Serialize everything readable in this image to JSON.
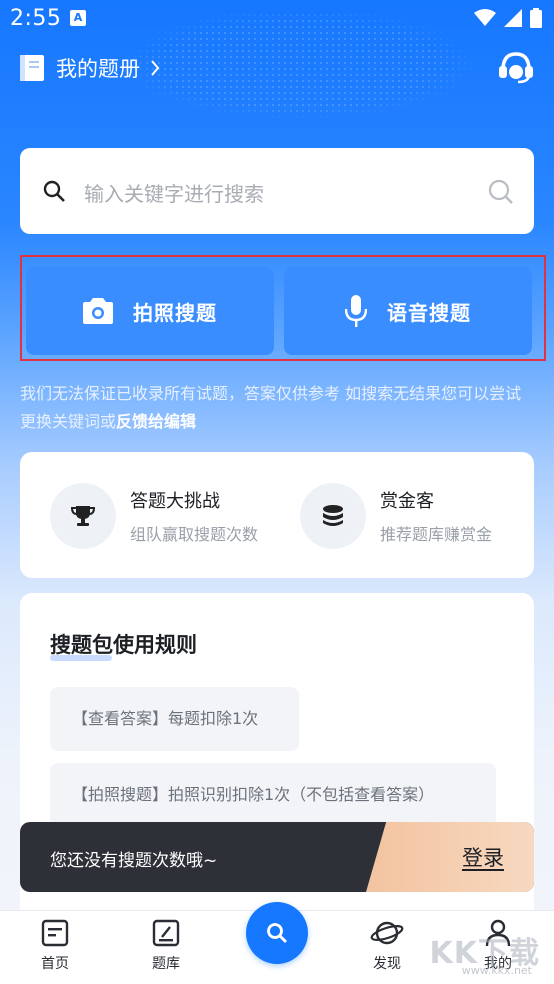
{
  "status_bar": {
    "time": "2:55",
    "notif_badge": "A"
  },
  "header": {
    "title": "我的题册"
  },
  "search": {
    "placeholder": "输入关键字进行搜索"
  },
  "actions": {
    "photo_search": "拍照搜题",
    "voice_search": "语音搜题"
  },
  "notice": {
    "text": "我们无法保证已收录所有试题，答案仅供参考 如搜索无结果您可以尝试更换关键词或",
    "link": "反馈给编辑"
  },
  "features": [
    {
      "title": "答题大挑战",
      "subtitle": "组队赢取搜题次数",
      "icon": "trophy-icon"
    },
    {
      "title": "赏金客",
      "subtitle": "推荐题库赚赏金",
      "icon": "coins-icon"
    }
  ],
  "rules": {
    "title": "搜题包使用规则",
    "items": [
      "【查看答案】每题扣除1次",
      "【拍照搜题】拍照识别扣除1次（不包括查看答案）"
    ]
  },
  "login_bar": {
    "message": "您还没有搜题次数哦~",
    "button": "登录"
  },
  "tabbar": {
    "home": "首页",
    "bank": "题库",
    "discover": "发现",
    "mine": "我的"
  },
  "watermark": {
    "text": "KK下载",
    "sub": "www.kkx.net"
  },
  "colors": {
    "primary": "#1677ff",
    "highlight_border": "#e0323f",
    "login_accent": "#f3c3a0"
  }
}
